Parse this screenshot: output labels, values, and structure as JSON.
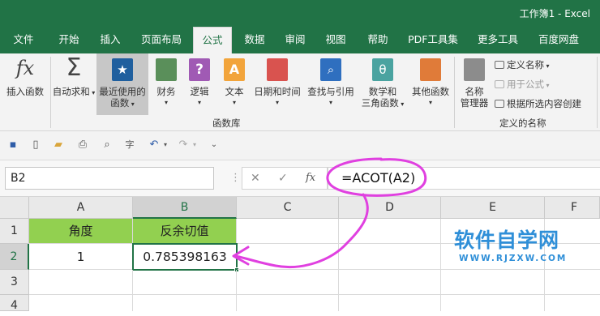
{
  "titlebar": {
    "doc_title": "工作簿1  -  Excel"
  },
  "menu_tabs": [
    "文件",
    "开始",
    "插入",
    "页面布局",
    "公式",
    "数据",
    "审阅",
    "视图",
    "帮助",
    "PDF工具集",
    "更多工具",
    "百度网盘"
  ],
  "active_tab": "公式",
  "ribbon": {
    "insert_function": {
      "glyph": "fx",
      "label": "插入函数"
    },
    "autosum": {
      "glyph": "Σ",
      "label": "自动求和"
    },
    "recent": {
      "line1": "最近使用的",
      "line2": "函数"
    },
    "financial": "财务",
    "logical": "逻辑",
    "text": "文本",
    "datetime": "日期和时间",
    "lookup": "查找与引用",
    "math_line1": "数学和",
    "math_line2": "三角函数",
    "other": "其他函数",
    "library_group": "函数库",
    "name_manager_line1": "名称",
    "name_manager_line2": "管理器",
    "define_name": "定义名称",
    "use_in_formula": "用于公式",
    "create_from_selection": "根据所选内容创建",
    "names_group": "定义的名称"
  },
  "formula_bar": {
    "name_box": "B2",
    "cancel_glyph": "✕",
    "enter_glyph": "✓",
    "fx_glyph": "fx",
    "formula": "=ACOT(A2)"
  },
  "grid": {
    "columns": [
      "A",
      "B",
      "C",
      "D",
      "E",
      "F"
    ],
    "rows": [
      "1",
      "2",
      "3",
      "4"
    ],
    "header_row": {
      "a": "角度",
      "b": "反余切值"
    },
    "data_row": {
      "a": "1",
      "b": "0.785398163"
    }
  },
  "watermark": {
    "text": "软件自学网",
    "url": "WWW.RJZXW.COM"
  },
  "colors": {
    "excel_green": "#217346",
    "cell_fill": "#92d050",
    "annotation": "#e040e0",
    "watermark": "#2f8fd8"
  }
}
